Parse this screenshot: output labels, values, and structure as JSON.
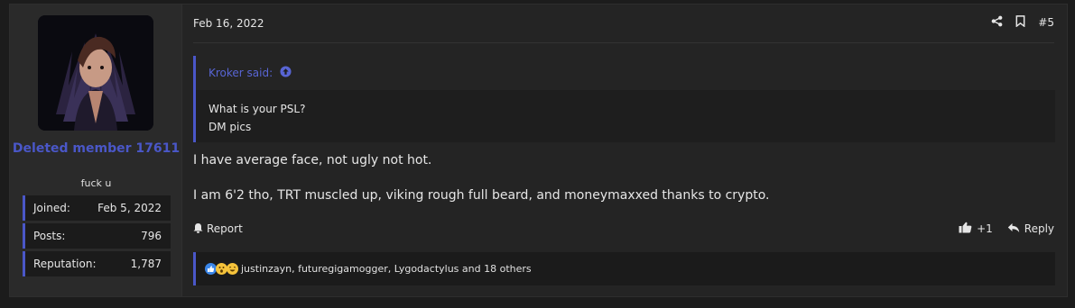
{
  "user": {
    "name": "Deleted member 17611",
    "title": "fuck u",
    "stats": [
      {
        "label": "Joined:",
        "value": "Feb 5, 2022"
      },
      {
        "label": "Posts:",
        "value": "796"
      },
      {
        "label": "Reputation:",
        "value": "1,787"
      }
    ]
  },
  "post": {
    "date": "Feb 16, 2022",
    "number": "#5",
    "quote": {
      "author": "Kroker said:",
      "lines": [
        "What is your PSL?",
        "DM pics"
      ]
    },
    "message_lines": [
      "I have average face, not ugly not hot.",
      "I am 6'2 tho, TRT muscled up, viking rough full beard, and moneymaxxed thanks to crypto."
    ],
    "actions": {
      "report": "Report",
      "like_count": "+1",
      "reply": "Reply"
    },
    "reactions_text": "justinzayn, futuregigamogger, Lygodactylus and 18 others"
  },
  "icons": [
    "share-icon",
    "bookmark-icon",
    "expand-quote-icon",
    "report-icon",
    "like-icon",
    "reply-icon"
  ],
  "colors": {
    "accent": "#4a57c8",
    "background": "#1c1c1c",
    "panel": "#242424"
  }
}
